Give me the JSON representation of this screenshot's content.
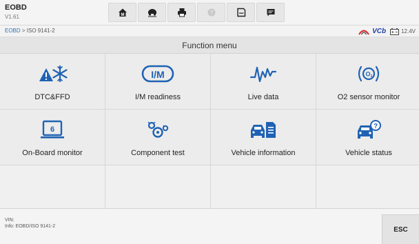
{
  "app": {
    "title": "EOBD",
    "version": "V1.61"
  },
  "toolbar": {
    "buttons": [
      {
        "name": "home-button",
        "icon": "home-icon"
      },
      {
        "name": "vehicle-swap-button",
        "icon": "vehicle-swap-icon"
      },
      {
        "name": "print-button",
        "icon": "printer-icon"
      },
      {
        "name": "help-button",
        "icon": "help-icon",
        "disabled": true
      },
      {
        "name": "save-button",
        "icon": "save-icon"
      },
      {
        "name": "data-logging-button",
        "icon": "chat-log-icon"
      }
    ]
  },
  "breadcrumb": {
    "link": "EOBD",
    "separator": " > ",
    "current": "ISO 9141-2"
  },
  "status": {
    "vci_label": "VCb",
    "battery_voltage": "12.4V",
    "accent_color": "#d8242b"
  },
  "menu": {
    "title": "Function menu",
    "items": [
      {
        "label": "DTC&FFD",
        "icon": "engine-warning-snowflake-icon"
      },
      {
        "label": "I/M readiness",
        "icon": "im-readiness-icon"
      },
      {
        "label": "Live data",
        "icon": "waveform-icon"
      },
      {
        "label": "O2 sensor monitor",
        "icon": "o2-sensor-icon"
      },
      {
        "label": "On-Board monitor",
        "icon": "onboard-monitor-icon"
      },
      {
        "label": "Component test",
        "icon": "component-gears-icon"
      },
      {
        "label": "Vehicle information",
        "icon": "vehicle-document-icon"
      },
      {
        "label": "Vehicle status",
        "icon": "vehicle-question-icon"
      }
    ],
    "icon_color": "#1f62b4"
  },
  "footer": {
    "vin": "VIN:",
    "info": "Info: EOBD/ISO 9141-2",
    "esc_label": "ESC"
  }
}
